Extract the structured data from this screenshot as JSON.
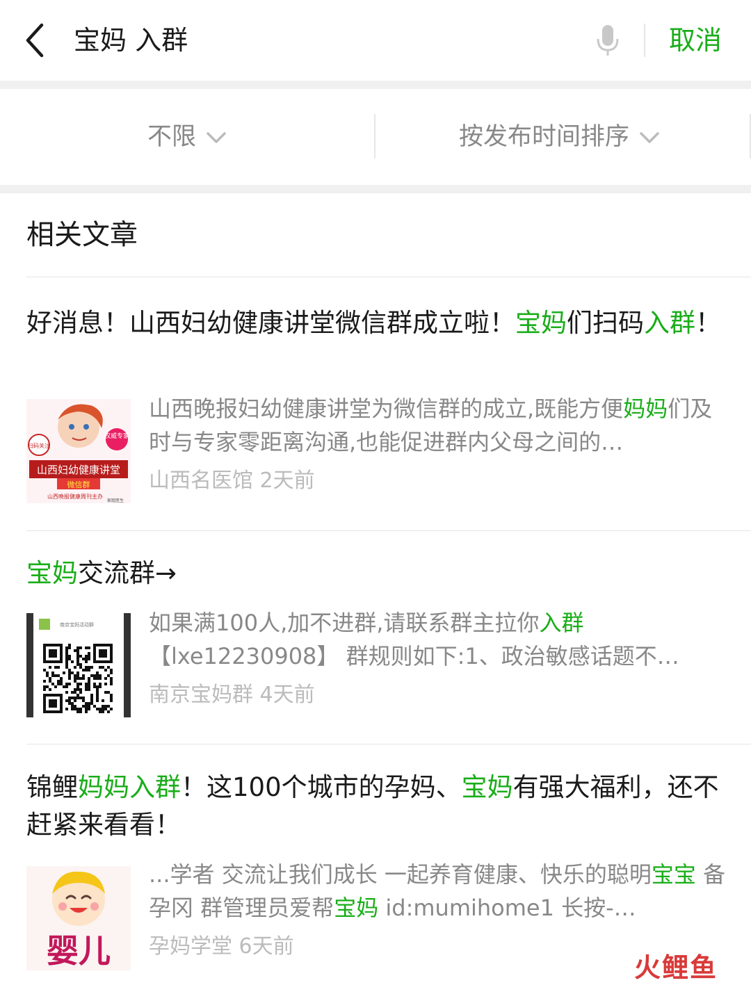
{
  "search": {
    "query": "宝妈 入群",
    "cancel_label": "取消"
  },
  "filters": [
    {
      "label": "不限"
    },
    {
      "label": "按发布时间排序"
    }
  ],
  "section": {
    "title": "相关文章"
  },
  "articles": [
    {
      "title": [
        {
          "t": "好消息！山西妇幼健康讲堂微信群成立啦！",
          "h": false
        },
        {
          "t": "宝妈",
          "h": true
        },
        {
          "t": "们扫码",
          "h": false
        },
        {
          "t": "入群",
          "h": true
        },
        {
          "t": "！",
          "h": false
        }
      ],
      "desc": [
        {
          "t": "山西晚报妇幼健康讲堂为微信群的成立,既能方便",
          "h": false
        },
        {
          "t": "妈妈",
          "h": true
        },
        {
          "t": "们及时与专家零距离沟通,也能促进群内父母之间的…",
          "h": false
        }
      ],
      "source": "山西名医馆",
      "time": "2天前",
      "thumb": {
        "banner": "山西妇幼健康讲堂",
        "sub": "微信群",
        "foot": "山西晚报健康周刊主办",
        "badge": "扫码关注",
        "tag": "权威专家",
        "mark": "家庭医生"
      }
    },
    {
      "title": [
        {
          "t": "宝妈",
          "h": true
        },
        {
          "t": "交流群→",
          "h": false
        }
      ],
      "desc": [
        {
          "t": "如果满100人,加不进群,请联系群主拉你",
          "h": false
        },
        {
          "t": "入群",
          "h": true
        },
        {
          "t": "【lxe12230908】 群规则如下:1、政治敏感话题不…",
          "h": false
        }
      ],
      "source": "南京宝妈群",
      "time": "4天前",
      "thumb": {
        "header": "南京宝妈活动群"
      }
    },
    {
      "title": [
        {
          "t": "锦鲤",
          "h": false
        },
        {
          "t": "妈妈入群",
          "h": true
        },
        {
          "t": "！这100个城市的孕妈、",
          "h": false
        },
        {
          "t": "宝妈",
          "h": true
        },
        {
          "t": "有强大福利，还不赶紧来看看！",
          "h": false
        }
      ],
      "desc": [
        {
          "t": "...学者 交流让我们成长 一起养育健康、快乐的聪明",
          "h": false
        },
        {
          "t": "宝宝",
          "h": true
        },
        {
          "t": " 备孕冈 群管理员爱帮",
          "h": false
        },
        {
          "t": "宝妈",
          "h": true
        },
        {
          "t": " id:mumihome1 长按-…",
          "h": false
        }
      ],
      "source": "孕妈学堂",
      "time": "6天前",
      "thumb": {
        "text": "婴儿"
      }
    }
  ],
  "watermark": "火鲤鱼",
  "colors": {
    "accent": "#1aad19",
    "muted": "#888888",
    "meta": "#bbbbbb"
  },
  "icons": {
    "back": "chevron-left-icon",
    "mic": "microphone-icon",
    "dropdown": "chevron-down-icon"
  }
}
